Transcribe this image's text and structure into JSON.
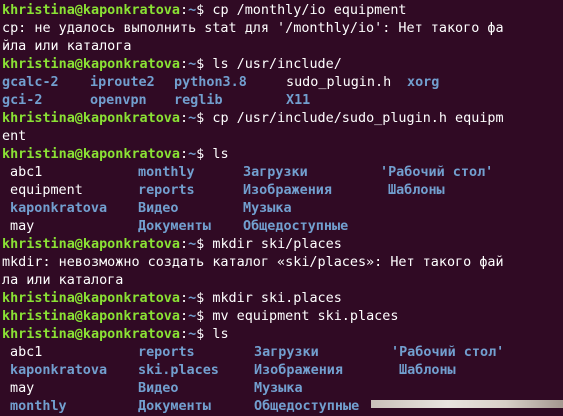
{
  "colors": {
    "background": "#300a24",
    "prompt_user": "#8ae234",
    "directory": "#729fcf",
    "text": "#ffffff"
  },
  "prompt": {
    "user_host": "khristina@kaponkratova",
    "sep": ":",
    "path": "~",
    "symbol": "$ "
  },
  "lines": [
    {
      "type": "prompt",
      "cmd": "cp /monthly/io equipment"
    },
    {
      "type": "text",
      "text": "cp: не удалось выполнить stat для '/monthly/io': Нет такого фа"
    },
    {
      "type": "text",
      "text": "йла или каталога"
    },
    {
      "type": "prompt",
      "cmd": "ls /usr/include/"
    },
    {
      "type": "ls",
      "widths": [
        88,
        84,
        112,
        121,
        60
      ],
      "items": [
        {
          "name": "gcalc-2",
          "kind": "dir"
        },
        {
          "name": "iproute2",
          "kind": "dir"
        },
        {
          "name": "python3.8",
          "kind": "dir"
        },
        {
          "name": "sudo_plugin.h",
          "kind": "file"
        },
        {
          "name": "xorg",
          "kind": "dir"
        }
      ]
    },
    {
      "type": "ls",
      "widths": [
        88,
        84,
        112,
        121,
        60
      ],
      "items": [
        {
          "name": "gci-2",
          "kind": "dir"
        },
        {
          "name": "openvpn",
          "kind": "dir"
        },
        {
          "name": "reglib",
          "kind": "dir"
        },
        {
          "name": "X11",
          "kind": "dir"
        }
      ]
    },
    {
      "type": "prompt",
      "cmd": "cp /usr/include/sudo_plugin.h equipm"
    },
    {
      "type": "text",
      "text": "ent"
    },
    {
      "type": "prompt",
      "cmd": "ls"
    },
    {
      "type": "ls",
      "widths": [
        136,
        105,
        137,
        130
      ],
      "items": [
        {
          "name": "abc1",
          "kind": "file",
          "pad": true
        },
        {
          "name": "monthly",
          "kind": "dir"
        },
        {
          "name": "Загрузки",
          "kind": "dir"
        },
        {
          "name": "'Рабочий стол'",
          "kind": "dir"
        }
      ]
    },
    {
      "type": "ls",
      "widths": [
        136,
        105,
        137,
        130
      ],
      "items": [
        {
          "name": "equipment",
          "kind": "file",
          "pad": true
        },
        {
          "name": "reports",
          "kind": "dir"
        },
        {
          "name": "Изображения",
          "kind": "dir"
        },
        {
          "name": "Шаблоны",
          "kind": "dir",
          "pad": true
        }
      ]
    },
    {
      "type": "ls",
      "widths": [
        136,
        105,
        137,
        130
      ],
      "items": [
        {
          "name": "kaponkratova",
          "kind": "dir",
          "pad": true
        },
        {
          "name": "Видео",
          "kind": "dir"
        },
        {
          "name": "Музыка",
          "kind": "dir"
        }
      ]
    },
    {
      "type": "ls",
      "widths": [
        136,
        105,
        137,
        130
      ],
      "items": [
        {
          "name": "may",
          "kind": "file",
          "pad": true
        },
        {
          "name": "Документы",
          "kind": "dir"
        },
        {
          "name": "Общедоступные",
          "kind": "dir"
        }
      ]
    },
    {
      "type": "prompt",
      "cmd": "mkdir ski/places"
    },
    {
      "type": "text",
      "text": "mkdir: невозможно создать каталог «ski/places»: Нет такого фай"
    },
    {
      "type": "text",
      "text": "ла или каталога"
    },
    {
      "type": "prompt",
      "cmd": "mkdir ski.places"
    },
    {
      "type": "prompt",
      "cmd": "mv equipment ski.places"
    },
    {
      "type": "prompt",
      "cmd": "ls"
    },
    {
      "type": "ls",
      "widths": [
        136,
        116,
        137,
        130
      ],
      "items": [
        {
          "name": "abc1",
          "kind": "file",
          "pad": true
        },
        {
          "name": "reports",
          "kind": "dir"
        },
        {
          "name": "Загрузки",
          "kind": "dir"
        },
        {
          "name": "'Рабочий стол'",
          "kind": "dir"
        }
      ]
    },
    {
      "type": "ls",
      "widths": [
        136,
        116,
        137,
        130
      ],
      "items": [
        {
          "name": "kaponkratova",
          "kind": "dir",
          "pad": true
        },
        {
          "name": "ski.places",
          "kind": "dir"
        },
        {
          "name": "Изображения",
          "kind": "dir"
        },
        {
          "name": "Шаблоны",
          "kind": "dir",
          "pad": true
        }
      ]
    },
    {
      "type": "ls",
      "widths": [
        136,
        116,
        137,
        130
      ],
      "items": [
        {
          "name": "may",
          "kind": "file",
          "pad": true
        },
        {
          "name": "Видео",
          "kind": "dir"
        },
        {
          "name": "Музыка",
          "kind": "dir"
        }
      ]
    },
    {
      "type": "ls",
      "widths": [
        136,
        116,
        137,
        130
      ],
      "items": [
        {
          "name": "monthly",
          "kind": "dir",
          "pad": true
        },
        {
          "name": "Документы",
          "kind": "dir"
        },
        {
          "name": "Общедоступные",
          "kind": "dir"
        }
      ]
    }
  ]
}
